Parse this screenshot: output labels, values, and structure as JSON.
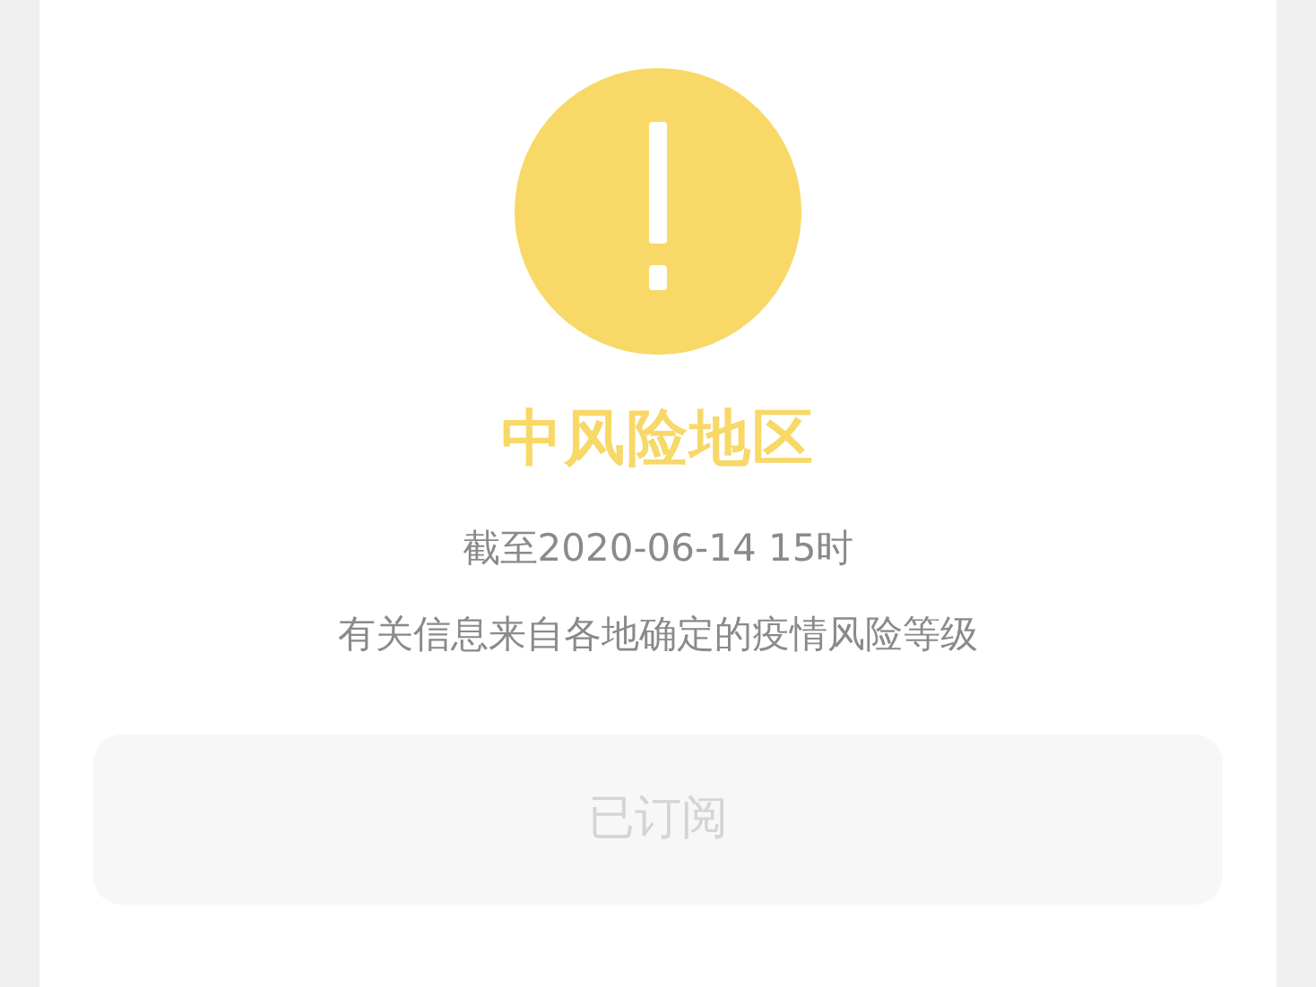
{
  "status": {
    "kind": "warning",
    "title": "中风险地区"
  },
  "lines": [
    "截至2020-06-14 15时",
    "有关信息来自各地确定的疫情风险等级"
  ],
  "subscribe_button": {
    "label": "已订阅",
    "disabled": true
  }
}
